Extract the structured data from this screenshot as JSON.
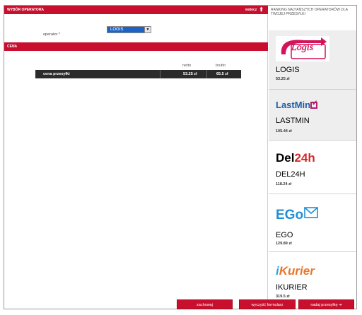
{
  "header": {
    "title": "WYBÓR OPERATORA",
    "back_label": "wstecz"
  },
  "operator_field": {
    "label": "operator",
    "required_mark": "*",
    "selected": "LOGIS"
  },
  "cena_section": {
    "title": "CENA"
  },
  "price_table": {
    "headers": {
      "netto": "netto",
      "brutto": "brutto"
    },
    "row": {
      "label": "cena przesyłki",
      "netto": "53.25 zł",
      "brutto": "65.5 zł"
    }
  },
  "sidebar": {
    "heading": "RANKING NAJTAŃSZYCH OPERATORÓW DLA TWOJEJ PRZESYŁKI",
    "operators": [
      {
        "name": "LOGIS",
        "price": "53.25 zł",
        "logo_text": "Logis"
      },
      {
        "name": "LASTMIN",
        "price": "105.44 zł",
        "logo_text": "LastMin"
      },
      {
        "name": "DEL24H",
        "price": "118.24 zł",
        "logo_text_a": "Del",
        "logo_text_b": "24h"
      },
      {
        "name": "EGO",
        "price": "129.89 zł",
        "logo_text": "EGo"
      },
      {
        "name": "IKURIER",
        "price": "319.5 zł",
        "logo_text_a": "i",
        "logo_text_b": "Kurier"
      }
    ]
  },
  "buttons": {
    "save": "zachowaj",
    "clear": "wyczyść formularz",
    "send": "nadaj przesyłkę ➜"
  },
  "colors": {
    "accent": "#c8102e",
    "dark_row": "#2b2b2b",
    "select_blue": "#1d63c7"
  }
}
